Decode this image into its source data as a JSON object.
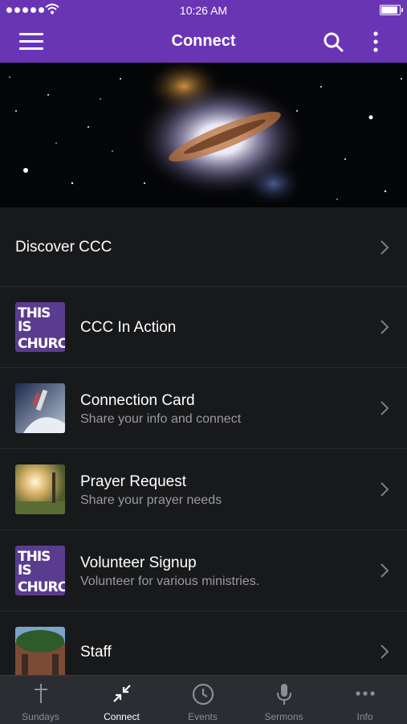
{
  "status": {
    "time": "10:26 AM"
  },
  "header": {
    "title": "Connect",
    "icons": [
      "menu-icon",
      "search-icon",
      "more-icon"
    ]
  },
  "colors": {
    "accent": "#6a35b5",
    "background": "#18191b",
    "tabbar": "#2b2d32",
    "subtitle": "#9a9a9f"
  },
  "list": {
    "items": [
      {
        "title": "Discover CCC",
        "subtitle": ""
      },
      {
        "title": "CCC In Action",
        "subtitle": "",
        "thumb_text1": "THIS IS",
        "thumb_text2": "CHURCH!"
      },
      {
        "title": "Connection Card",
        "subtitle": "Share your info and connect"
      },
      {
        "title": "Prayer Request",
        "subtitle": "Share your prayer needs"
      },
      {
        "title": "Volunteer Signup",
        "subtitle": "Volunteer for various ministries.",
        "thumb_text1": "THIS IS",
        "thumb_text2": "CHURCH!"
      },
      {
        "title": "Staff",
        "subtitle": ""
      }
    ]
  },
  "tabs": [
    {
      "label": "Sundays",
      "icon": "cross-icon"
    },
    {
      "label": "Connect",
      "icon": "connect-icon",
      "active": true
    },
    {
      "label": "Events",
      "icon": "clock-icon"
    },
    {
      "label": "Sermons",
      "icon": "microphone-icon"
    },
    {
      "label": "Info",
      "icon": "more-horizontal-icon"
    }
  ]
}
